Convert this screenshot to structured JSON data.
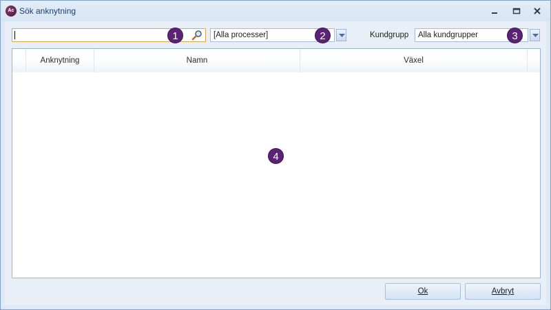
{
  "window": {
    "title": "Sök anknytning",
    "icon_text": "Ac"
  },
  "toolbar": {
    "search": {
      "value": "",
      "placeholder": ""
    },
    "process_combo": {
      "selected": "[Alla processer]"
    },
    "customer_group_label": "Kundgrupp",
    "customer_group_combo": {
      "selected": "Alla kundgrupper"
    }
  },
  "grid": {
    "columns": [
      "Anknytning",
      "Namn",
      "Växel"
    ],
    "rows": []
  },
  "markers": [
    "1",
    "2",
    "3",
    "4"
  ],
  "buttons": {
    "ok_label": "Ok",
    "cancel_label": "Avbryt"
  },
  "icons": {
    "window_controls": [
      "minimize-icon",
      "maximize-icon",
      "close-icon"
    ],
    "search": "magnifier-icon",
    "dropdown": "chevron-down-icon"
  },
  "colors": {
    "marker": "#5a2376",
    "window_border": "#7fa2c9",
    "search_focus_border": "#e1a748"
  }
}
